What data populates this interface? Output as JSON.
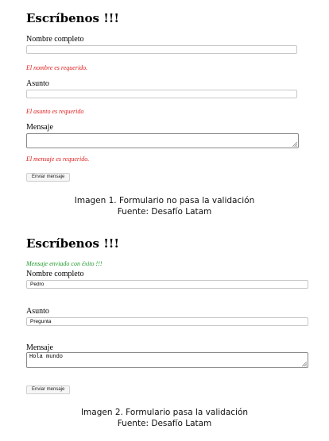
{
  "form1": {
    "title": "Escríbenos !!!",
    "name_label": "Nombre completo",
    "name_value": "",
    "name_error": "El nombre es requerido.",
    "subject_label": "Asunto",
    "subject_value": "",
    "subject_error": "El asunto es requerido",
    "message_label": "Mensaje",
    "message_value": "",
    "message_error": "El mensaje es requerido.",
    "submit_label": "Enviar mensaje"
  },
  "caption1": {
    "line1": "Imagen 1. Formulario no pasa la validación",
    "line2": "Fuente: Desafío Latam"
  },
  "form2": {
    "title": "Escríbenos !!!",
    "success_message": "Mensaje enviado con éxito !!!",
    "name_label": "Nombre completo",
    "name_value": "Pedro",
    "subject_label": "Asunto",
    "subject_value": "Pregunta",
    "message_label": "Mensaje",
    "message_value": "Hola mundo",
    "submit_label": "Enviar mensaje"
  },
  "caption2": {
    "line1": "Imagen 2. Formulario pasa la validación",
    "line2": "Fuente: Desafío Latam"
  },
  "colors": {
    "error": "#e01b1b",
    "success": "#1f9a2a"
  },
  "icons": [
    "resize-grip-icon"
  ]
}
